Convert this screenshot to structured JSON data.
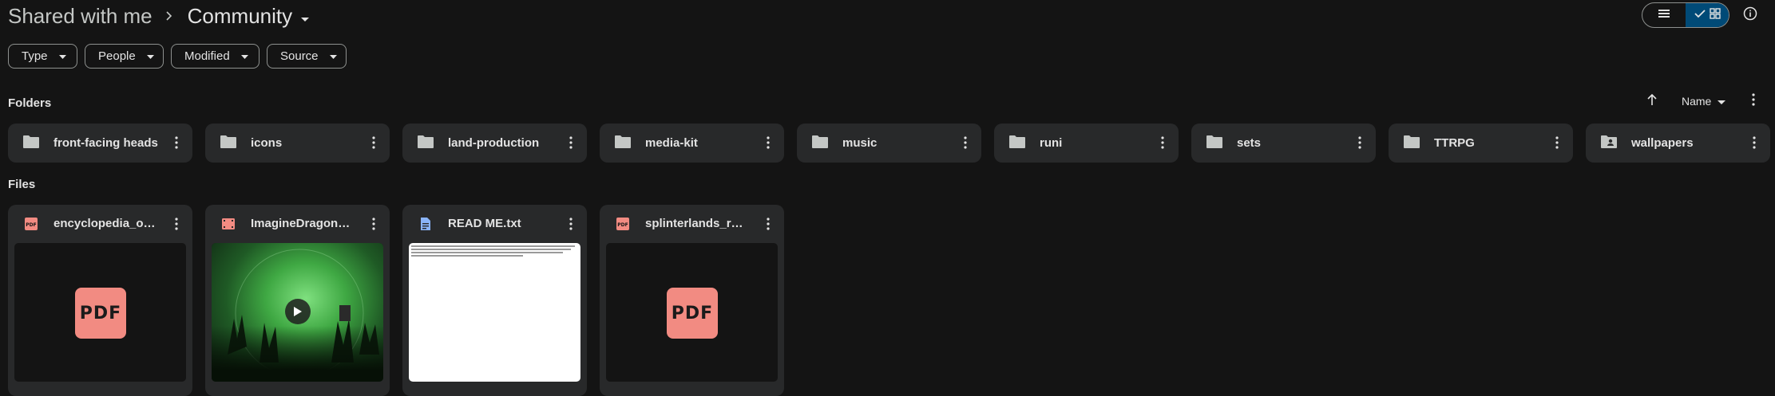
{
  "breadcrumb": {
    "root": "Shared with me",
    "current": "Community"
  },
  "filters": [
    {
      "label": "Type"
    },
    {
      "label": "People"
    },
    {
      "label": "Modified"
    },
    {
      "label": "Source"
    }
  ],
  "sections": {
    "folders": "Folders",
    "files": "Files"
  },
  "sort": {
    "label": "Name",
    "direction": "ascending"
  },
  "view": {
    "active": "grid"
  },
  "folders": [
    {
      "name": "front-facing heads",
      "icon": "folder-icon"
    },
    {
      "name": "icons",
      "icon": "folder-icon"
    },
    {
      "name": "land-production",
      "icon": "folder-icon"
    },
    {
      "name": "media-kit",
      "icon": "folder-icon"
    },
    {
      "name": "music",
      "icon": "folder-icon"
    },
    {
      "name": "runi",
      "icon": "folder-icon"
    },
    {
      "name": "sets",
      "icon": "folder-icon"
    },
    {
      "name": "TTRPG",
      "icon": "folder-icon"
    },
    {
      "name": "wallpapers",
      "icon": "shared-folder-icon"
    }
  ],
  "files": [
    {
      "name": "encyclopedia_orig...",
      "type": "pdf",
      "icon": "pdf-icon",
      "preview": "PDF"
    },
    {
      "name": "ImagineDragons_...",
      "type": "video",
      "icon": "video-icon",
      "preview": ""
    },
    {
      "name": "READ ME.txt",
      "type": "text",
      "icon": "doc-icon",
      "preview": ""
    },
    {
      "name": "splinterlands_run...",
      "type": "pdf",
      "icon": "pdf-icon",
      "preview": "PDF"
    }
  ],
  "colors": {
    "background": "#141414",
    "card": "#28292a",
    "pdf": "#f28b82",
    "doc": "#8ab4f8",
    "toggle_active": "#004a77"
  }
}
